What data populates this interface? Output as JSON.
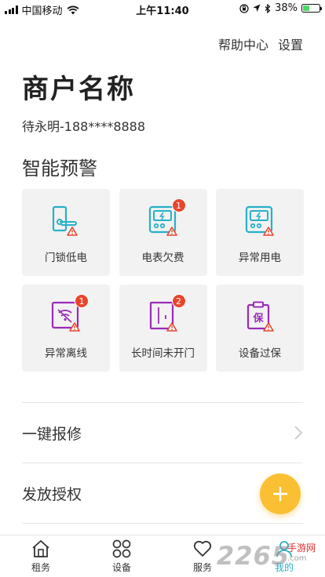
{
  "status_bar": {
    "carrier": "中国移动",
    "time": "上午11:40",
    "battery": "38%",
    "battery_level": 0.38
  },
  "header": {
    "help_label": "帮助中心",
    "settings_label": "设置",
    "merchant_name": "商户名称",
    "contact": "待永明-188****8888"
  },
  "warnings": {
    "title": "智能预警",
    "tiles": [
      {
        "label": "门锁低电",
        "icon": "door-lock-low-battery-icon"
      },
      {
        "label": "电表欠费",
        "icon": "electric-meter-arrears-icon",
        "badge": "1"
      },
      {
        "label": "异常用电",
        "icon": "abnormal-power-icon"
      },
      {
        "label": "异常离线",
        "icon": "offline-wifi-icon",
        "badge": "1"
      },
      {
        "label": "长时间未开门",
        "icon": "door-unopened-icon",
        "badge": "2"
      },
      {
        "label": "设备过保",
        "icon": "warranty-expired-icon"
      }
    ]
  },
  "menu": {
    "repair": "一键报修",
    "authorize": "发放授权"
  },
  "tabbar": {
    "tabs": [
      {
        "label": "租务",
        "icon": "home-icon"
      },
      {
        "label": "设备",
        "icon": "device-grid-icon"
      },
      {
        "label": "服务",
        "icon": "heart-icon"
      },
      {
        "label": "我的",
        "icon": "user-icon"
      }
    ]
  },
  "colors": {
    "teal": "#27b1c9",
    "purple": "#9b2bb9",
    "warning_red": "#e8452c",
    "fab": "#fbbf33",
    "active_tab": "#2cb0c6"
  },
  "watermark": {
    "brand": "2265",
    "sub": "手游网",
    "url": ".com"
  }
}
